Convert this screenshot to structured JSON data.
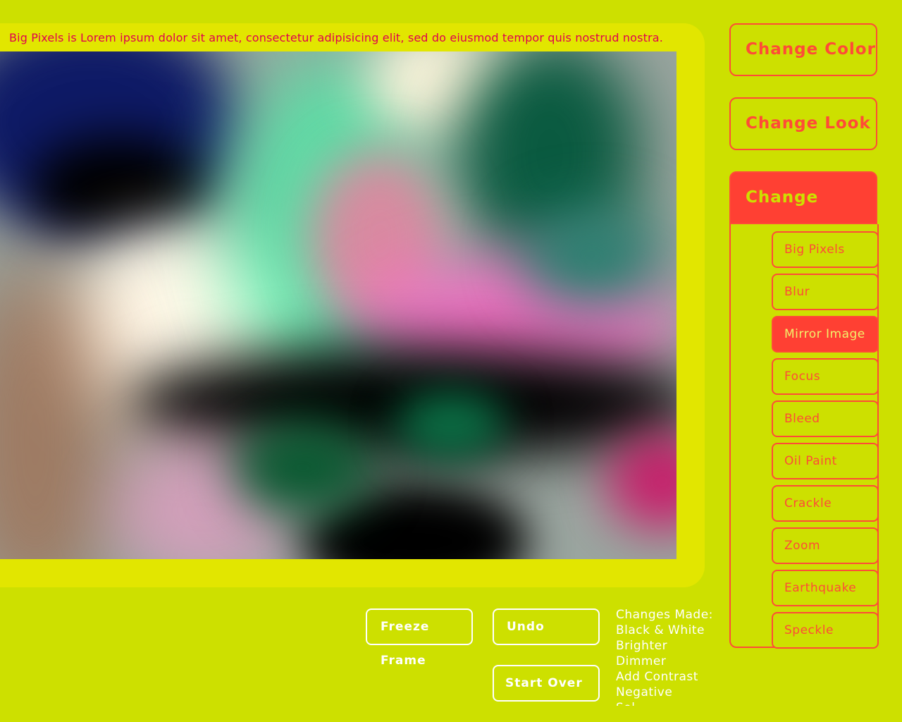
{
  "caption": "Big Pixels is Lorem ipsum dolor sit amet, consectetur adipisicing elit, sed do eiusmod tempor quis nostrud nostra.",
  "menu": {
    "change_color": "Change Color",
    "change_look": "Change Look",
    "change_shape": "Change Shape"
  },
  "shape_effects": [
    {
      "label": "Big Pixels",
      "selected": false
    },
    {
      "label": "Blur",
      "selected": false
    },
    {
      "label": "Mirror Image",
      "selected": true
    },
    {
      "label": "Focus",
      "selected": false
    },
    {
      "label": "Bleed",
      "selected": false
    },
    {
      "label": "Oil Paint",
      "selected": false
    },
    {
      "label": "Crackle",
      "selected": false
    },
    {
      "label": "Zoom",
      "selected": false
    },
    {
      "label": "Earthquake",
      "selected": false
    },
    {
      "label": "Speckle",
      "selected": false
    }
  ],
  "controls": {
    "freeze_frame": "Freeze Frame",
    "undo": "Undo",
    "start_over": "Start Over"
  },
  "changes": {
    "heading": "Changes Made:",
    "items": [
      "Black & White",
      "Brighter",
      "Dimmer",
      "Add Contrast",
      "Negative",
      "Sol..."
    ]
  },
  "colors": {
    "background": "#cde000",
    "panel": "#e2e600",
    "accent": "#ff4b37",
    "caption_text": "#e0004f"
  }
}
